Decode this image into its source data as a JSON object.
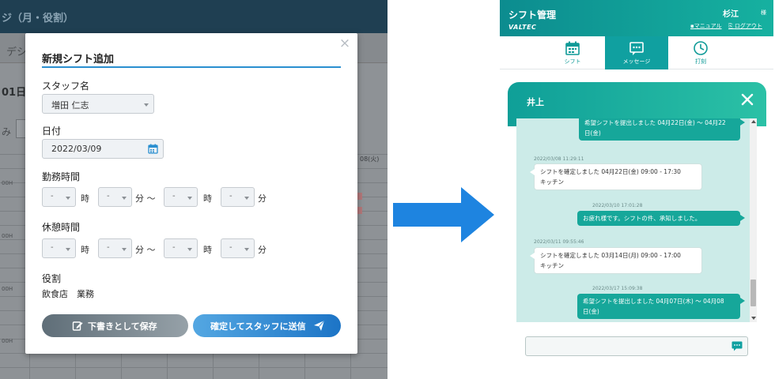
{
  "left_app": {
    "header_title": "ジ（月・役割）",
    "sub_text": "デシ",
    "date_text": "01日",
    "mi_text": "み",
    "hour_labels": [
      "00H",
      "00H",
      "00H",
      "00H"
    ],
    "col_date": "08(火)"
  },
  "modal": {
    "title": "新規シフト追加",
    "close_glyph": "×",
    "staff_label": "スタッフ名",
    "staff_value": "増田 仁志",
    "date_label": "日付",
    "date_value": "2022/03/09",
    "work_time_label": "勤務時間",
    "break_time_label": "休憩時間",
    "placeholder": "-",
    "unit_hour": "時",
    "unit_minute_tilde": "分 〜",
    "unit_minute": "分",
    "role_label": "役割",
    "role_value": "飲食店　業務",
    "draft_button": "下書きとして保存",
    "send_button": "確定してスタッフに送信"
  },
  "phone": {
    "app_title": "シフト管理",
    "brand": "VALTEC",
    "user_name": "杉江",
    "user_suffix": "様",
    "manual_link": "マニュアル",
    "logout_link": "ログアウト",
    "nav": [
      {
        "label": "シフト",
        "icon": "calendar-icon"
      },
      {
        "label": "メッセージ",
        "icon": "message-icon"
      },
      {
        "label": "打刻",
        "icon": "clock-icon"
      }
    ],
    "chat_partner": "井上",
    "messages": [
      {
        "side": "right",
        "time": "",
        "lines": [
          "希望シフトを提出しました 04月22日(金) 〜 04月22",
          "日(金)"
        ]
      },
      {
        "side": "left",
        "time": "2022/03/08 11:29:11",
        "lines": [
          "シフトを確定しました 04月22日(金) 09:00 - 17:30",
          "キッチン"
        ]
      },
      {
        "side": "right",
        "time": "2022/03/10 17:01:28",
        "lines": [
          "お疲れ様です。シフトの件、承知しました。"
        ]
      },
      {
        "side": "left",
        "time": "2022/03/11 09:55:46",
        "lines": [
          "シフトを確定しました 03月14日(月) 09:00 - 17:00",
          "キッチン"
        ]
      },
      {
        "side": "right",
        "time": "2022/03/17 15:09:38",
        "lines": [
          "希望シフトを提出しました 04月07日(木) 〜 04月08",
          "日(金)"
        ]
      }
    ]
  },
  "colors": {
    "accent_blue": "#2a8fd0",
    "teal": "#10a0a0",
    "arrow_blue": "#1e84e0"
  }
}
